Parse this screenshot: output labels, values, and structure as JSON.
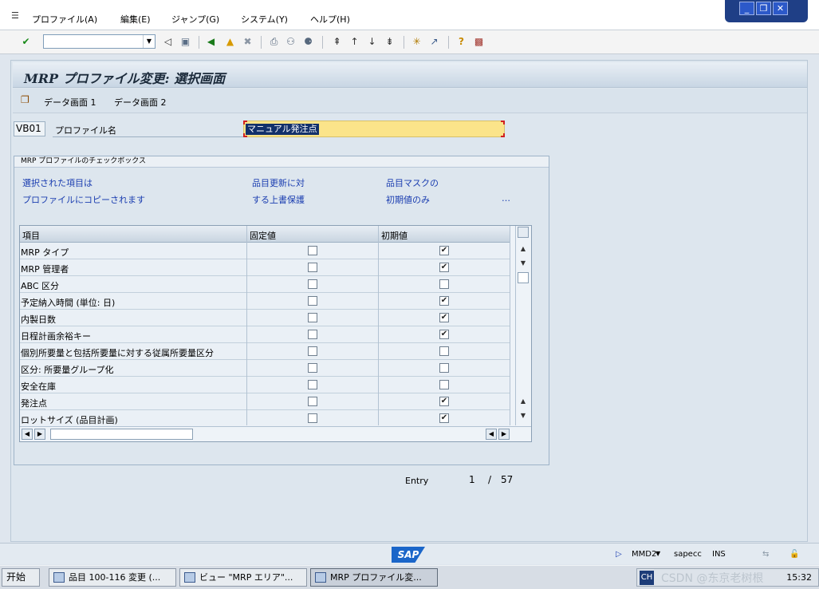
{
  "menubar": {
    "items": [
      "プロファイル(A)",
      "編集(E)",
      "ジャンプ(G)",
      "システム(Y)",
      "ヘルプ(H)"
    ]
  },
  "toolbar": {
    "command_value": ""
  },
  "window": {
    "title": "MRP プロファイル変更: 選択画面"
  },
  "appbar": {
    "data_screen_1": "データ画面 1",
    "data_screen_2": "データ画面 2"
  },
  "profile": {
    "code": "VB01",
    "label": "プロファイル名",
    "value": "マニュアル発注点"
  },
  "group": {
    "title": "MRP プロファイルのチェックボックス",
    "info": {
      "col1_line1": "選択された項目は",
      "col1_line2": "プロファイルにコピーされます",
      "col2_line1": "品目更新に対",
      "col2_line2": "する上書保護",
      "col3_line1": "品目マスクの",
      "col3_line2": "初期値のみ",
      "more": "…"
    },
    "table": {
      "headers": [
        "項目",
        "固定値",
        "初期値"
      ],
      "rows": [
        {
          "label": "MRP タイプ",
          "fixed": false,
          "initial": true
        },
        {
          "label": "MRP 管理者",
          "fixed": false,
          "initial": true
        },
        {
          "label": "ABC 区分",
          "fixed": false,
          "initial": false
        },
        {
          "label": "予定納入時間 (単位: 日)",
          "fixed": false,
          "initial": true
        },
        {
          "label": "内製日数",
          "fixed": false,
          "initial": true
        },
        {
          "label": "日程計画余裕キー",
          "fixed": false,
          "initial": true
        },
        {
          "label": "個別所要量と包括所要量に対する従属所要量区分",
          "fixed": false,
          "initial": false
        },
        {
          "label": "区分: 所要量グループ化",
          "fixed": false,
          "initial": false
        },
        {
          "label": "安全在庫",
          "fixed": false,
          "initial": false
        },
        {
          "label": "発注点",
          "fixed": false,
          "initial": true
        },
        {
          "label": "ロットサイズ (品目計画)",
          "fixed": false,
          "initial": true
        }
      ]
    }
  },
  "entry": {
    "label": "Entry",
    "current": "1",
    "separator": "/",
    "total": "57"
  },
  "statusbar": {
    "logo": "SAP",
    "transaction": "MMD2",
    "server": "sapecc",
    "mode": "INS"
  },
  "taskbar": {
    "start": "开始",
    "tasks": [
      "品目 100-116 変更 (...",
      "ビュー \"MRP エリア\"...",
      "MRP プロファイル変..."
    ],
    "lang": "CH",
    "clock": "15:32",
    "watermark": "CSDN @东京老树根"
  }
}
